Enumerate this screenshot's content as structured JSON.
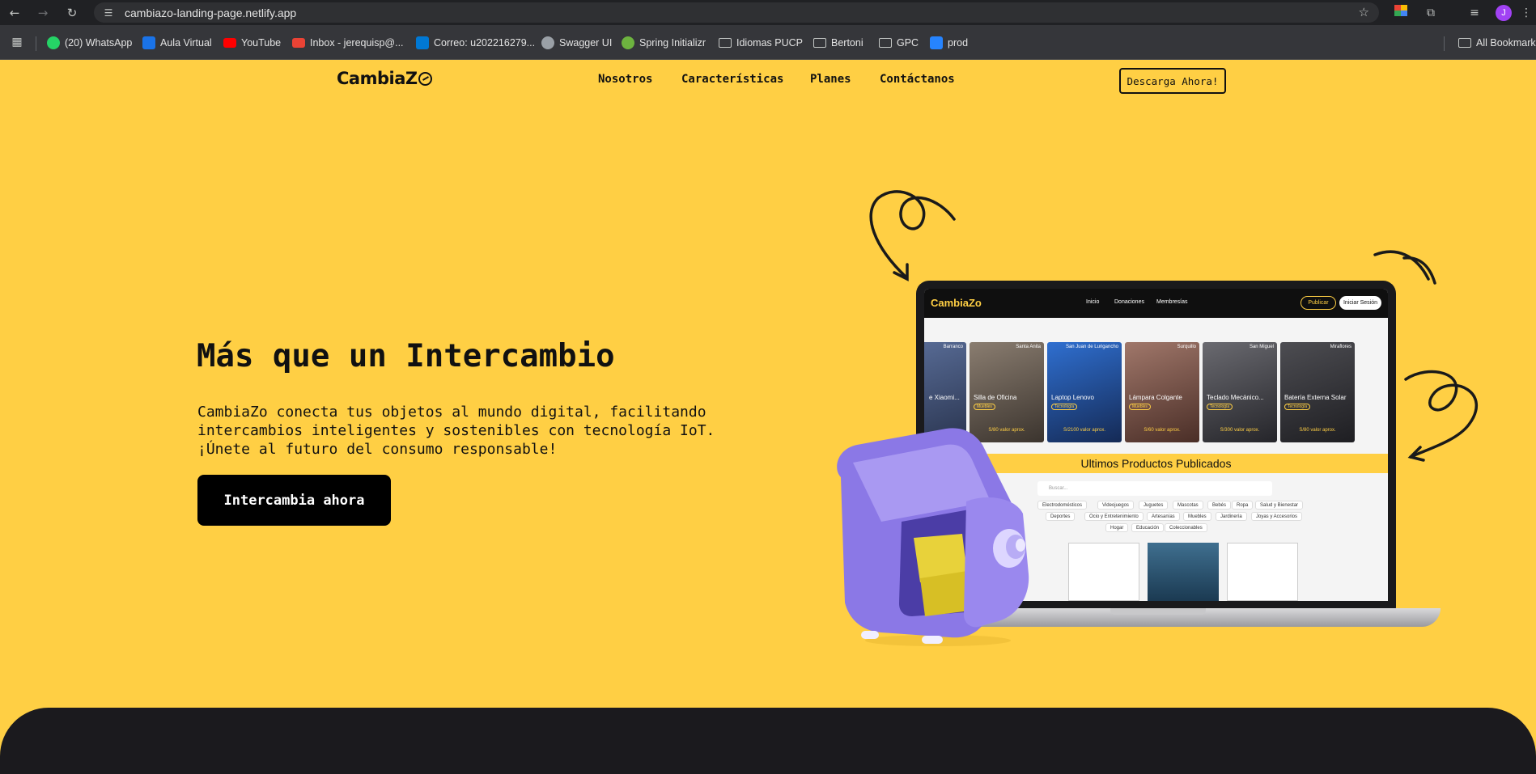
{
  "browser": {
    "url": "cambiazo-landing-page.netlify.app",
    "profile_initial": "J",
    "bookmarks": [
      {
        "label": "(20) WhatsApp",
        "icon": "whatsapp-icon",
        "color": "#25d366"
      },
      {
        "label": "Aula Virtual",
        "icon": "aula-virtual-icon",
        "color": "#1a73e8"
      },
      {
        "label": "YouTube",
        "icon": "youtube-icon",
        "color": "#ff0000"
      },
      {
        "label": "Inbox - jerequisp@...",
        "icon": "gmail-icon",
        "color": "#ea4335"
      },
      {
        "label": "Correo: u202216279...",
        "icon": "outlook-icon",
        "color": "#0078d4"
      },
      {
        "label": "Swagger UI",
        "icon": "globe-icon",
        "color": "#9aa0a6"
      },
      {
        "label": "Spring Initializr",
        "icon": "spring-icon",
        "color": "#6db33f"
      },
      {
        "label": "Idiomas PUCP",
        "icon": "folder-icon",
        "color": ""
      },
      {
        "label": "Bertoni",
        "icon": "folder-icon",
        "color": ""
      },
      {
        "label": "GPC",
        "icon": "folder-icon",
        "color": ""
      },
      {
        "label": "prod",
        "icon": "jira-icon",
        "color": "#2684ff"
      }
    ],
    "all_bookmarks_label": "All Bookmarks"
  },
  "site": {
    "logo_text": "CambiaZ",
    "nav": [
      "Nosotros",
      "Características",
      "Planes",
      "Contáctanos"
    ],
    "download_label": "Descarga Ahora!",
    "hero": {
      "title": "Más que un Intercambio",
      "description": "CambiaZo conecta tus objetos al mundo digital, facilitando intercambios inteligentes y sostenibles con tecnología IoT. ¡Únete al futuro del consumo responsable!",
      "cta_label": "Intercambia ahora"
    },
    "accent_color": "#ffcf44"
  },
  "mockup": {
    "logo": "CambiaZo",
    "nav": [
      "Inicio",
      "Donaciones",
      "Membresías"
    ],
    "publish_label": "Publicar",
    "login_label": "Iniciar Sesión",
    "cards": [
      {
        "name": "e Xiaomi...",
        "loc": "Barranco",
        "tag": "",
        "price": ""
      },
      {
        "name": "Silla de Oficina",
        "loc": "Santa Anita",
        "tag": "Muebles",
        "price": "S/80 valor aprox."
      },
      {
        "name": "Laptop Lenovo",
        "loc": "San Juan de Lurigancho",
        "tag": "Tecnología",
        "price": "S/2100 valor aprox."
      },
      {
        "name": "Lámpara Colgante",
        "loc": "Surquillo",
        "tag": "Muebles",
        "price": "S/60 valor aprox."
      },
      {
        "name": "Teclado Mecánico...",
        "loc": "San Miguel",
        "tag": "Tecnología",
        "price": "S/300 valor aprox."
      },
      {
        "name": "Batería Externa Solar",
        "loc": "Miraflores",
        "tag": "Tecnología",
        "price": "S/80 valor aprox."
      }
    ],
    "section_title": "Ultimos Productos Publicados",
    "search_placeholder": "Buscar...",
    "chips_row1": [
      "Electrodomésticos",
      "Videojuegos",
      "Juguetes",
      "Mascotas",
      "Bebés",
      "Ropa",
      "Salud y Bienestar"
    ],
    "chips_row2": [
      "Deportes",
      "Ocio y Entretenimiento",
      "Artesanías",
      "Muebles",
      "Jardinería",
      "Joyas y Accesorios"
    ],
    "chips_row3": [
      "Hogar",
      "Educación",
      "Coleccionables"
    ]
  }
}
